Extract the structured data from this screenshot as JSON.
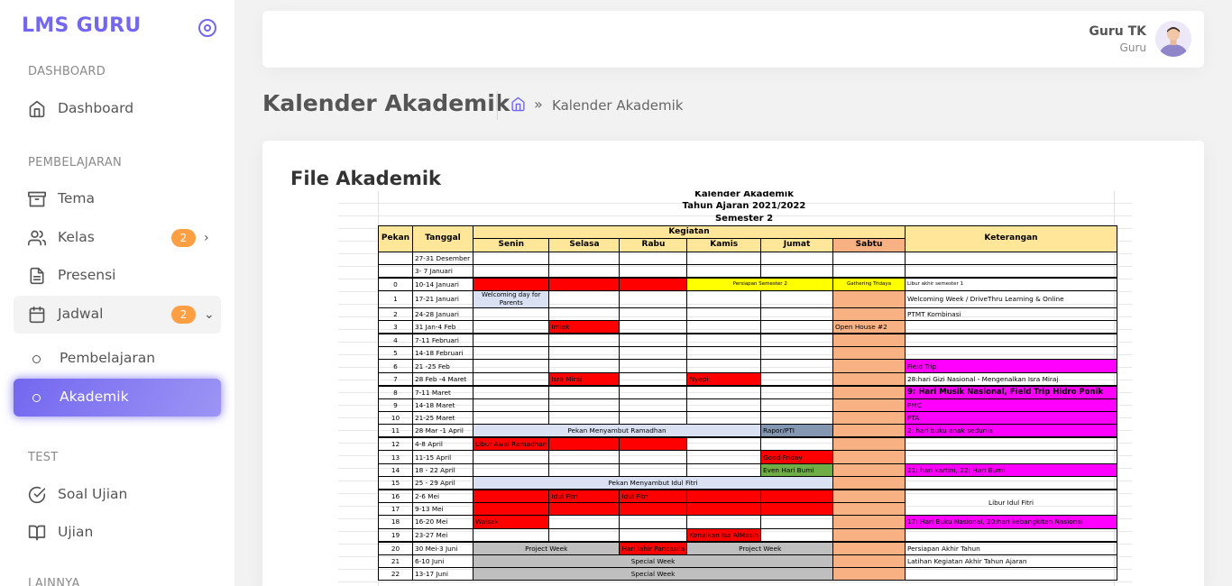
{
  "brand": {
    "name": "LMS GURU"
  },
  "sidebar": {
    "sections": [
      {
        "title": "DASHBOARD"
      },
      {
        "title": "PEMBELAJARAN"
      },
      {
        "title": "TEST"
      },
      {
        "title": "LAINNYA"
      }
    ],
    "items": {
      "dashboard": {
        "label": "Dashboard",
        "icon": "home-icon"
      },
      "tema": {
        "label": "Tema",
        "icon": "archive-icon"
      },
      "kelas": {
        "label": "Kelas",
        "icon": "users-icon",
        "badge": "2"
      },
      "presensi": {
        "label": "Presensi",
        "icon": "file-text-icon"
      },
      "jadwal": {
        "label": "Jadwal",
        "icon": "calendar-icon",
        "badge": "2"
      },
      "pembelajaran": {
        "label": "Pembelajaran"
      },
      "akademik": {
        "label": "Akademik"
      },
      "soal_ujian": {
        "label": "Soal Ujian",
        "icon": "check-circle-icon"
      },
      "ujian": {
        "label": "Ujian",
        "icon": "book-open-icon"
      }
    }
  },
  "user": {
    "name": "Guru TK",
    "role": "Guru"
  },
  "header": {
    "title": "Kalender Akademik",
    "breadcrumb_current": "Kalender Akademik",
    "breadcrumb_sep": "»"
  },
  "card": {
    "title": "File Akademik"
  },
  "sheet": {
    "title1": "Kalender Akademik",
    "title2": "Tahun Ajaran 2021/2022",
    "title3": "Semester 2",
    "headers": {
      "pekan": "Pekan",
      "tanggal": "Tanggal",
      "kegiatan": "Kegiatan",
      "keterangan": "Keterangan",
      "days": [
        "Senin",
        "Selasa",
        "Rabu",
        "Kamis",
        "Jumat",
        "Sabtu"
      ]
    },
    "rows": [
      {
        "pekan": "",
        "tanggal": "27-31 Desember"
      },
      {
        "pekan": "",
        "tanggal": "3- 7 Januari"
      },
      {
        "pekan": "0",
        "tanggal": "10-14 Januari",
        "kamis_jumat": "Persiapan Semester 2",
        "sabtu": "Gathering Tridaya",
        "ket": "Libur akhir semester 1"
      },
      {
        "pekan": "1",
        "tanggal": "17-21 Januari",
        "senin": "Welcoming day for Parents",
        "ket": "Welcoming Week / DriveThru Learning & Online"
      },
      {
        "pekan": "2",
        "tanggal": "24-28 Januari",
        "ket": "PTMT Kombinasi"
      },
      {
        "pekan": "3",
        "tanggal": "31 Jan-4 Feb",
        "selasa": "Imlek",
        "sabtu": "Open House #2"
      },
      {
        "pekan": "4",
        "tanggal": "7-11 Februari"
      },
      {
        "pekan": "5",
        "tanggal": "14-18 Februari"
      },
      {
        "pekan": "6",
        "tanggal": "21 -25 Feb",
        "ket": "Field Trip"
      },
      {
        "pekan": "7",
        "tanggal": "28 Feb -4 Maret",
        "selasa": "Isra Miraj",
        "kamis": "Nyepi",
        "ket": "28:hari Gizi Nasional - Mengenalkan Isra Miraj"
      },
      {
        "pekan": "8",
        "tanggal": "7-11 Maret",
        "ket": "9: Hari Musik Nasional, Field Trip Hidro Ponik"
      },
      {
        "pekan": "9",
        "tanggal": "14-18 Maret",
        "ket": "PMC"
      },
      {
        "pekan": "10",
        "tanggal": "21-25 Maret",
        "ket": "PTA"
      },
      {
        "pekan": "11",
        "tanggal": "28 Mar -1 April",
        "senin_rabu": "Pekan Menyambut Ramadhan",
        "jumat": "Rapor/PTI",
        "ket": "2: hari buku anak sedunia"
      },
      {
        "pekan": "12",
        "tanggal": "4-8 April",
        "senin": "Libur Awal Ramadhan"
      },
      {
        "pekan": "13",
        "tanggal": "11-15 April",
        "jumat": "Good Friday"
      },
      {
        "pekan": "14",
        "tanggal": "18 - 22 April",
        "jumat": "Even Hari Bumi",
        "ket": "21: hari kartini, 22: Hari Bumi"
      },
      {
        "pekan": "15",
        "tanggal": "25 - 29 April",
        "senin_jumat": "Pekan Menyambut Idul Fitri"
      },
      {
        "pekan": "16",
        "tanggal": "2-6 Mei",
        "selasa": "Idul Fitri",
        "rabu": "Idul Fitri",
        "ket": "Libur Idul Fitri"
      },
      {
        "pekan": "17",
        "tanggal": "9-13 Mei"
      },
      {
        "pekan": "18",
        "tanggal": "16-20 Mei",
        "senin": "Waisak",
        "ket": "17: Hari Buku Nasional, 20:hari kebangkitan Nasional"
      },
      {
        "pekan": "19",
        "tanggal": "23-27 Mei",
        "kamis": "Kenaikan Isa AlMasih"
      },
      {
        "pekan": "20",
        "tanggal": "30 Mei-3 Juni",
        "senin_selasa": "Project Week",
        "rabu": "Hari lahir Pancasila",
        "kamis_jumat": "Project Week",
        "ket": "Persiapan Akhir Tahun"
      },
      {
        "pekan": "21",
        "tanggal": "6-10 Juni",
        "senin_jumat": "Special Week",
        "ket": "Latihan Kegiatan Akhir Tahun Ajaran"
      },
      {
        "pekan": "22",
        "tanggal": "13-17 Juni",
        "senin_jumat": "Special Week"
      }
    ]
  },
  "colors": {
    "accent": "#7367f0",
    "badge": "#ff9f43",
    "red": "#ff0000",
    "yellow": "#ffff00",
    "saturday": "#f8b183",
    "magenta": "#ff00ff",
    "header": "#ffe699"
  }
}
